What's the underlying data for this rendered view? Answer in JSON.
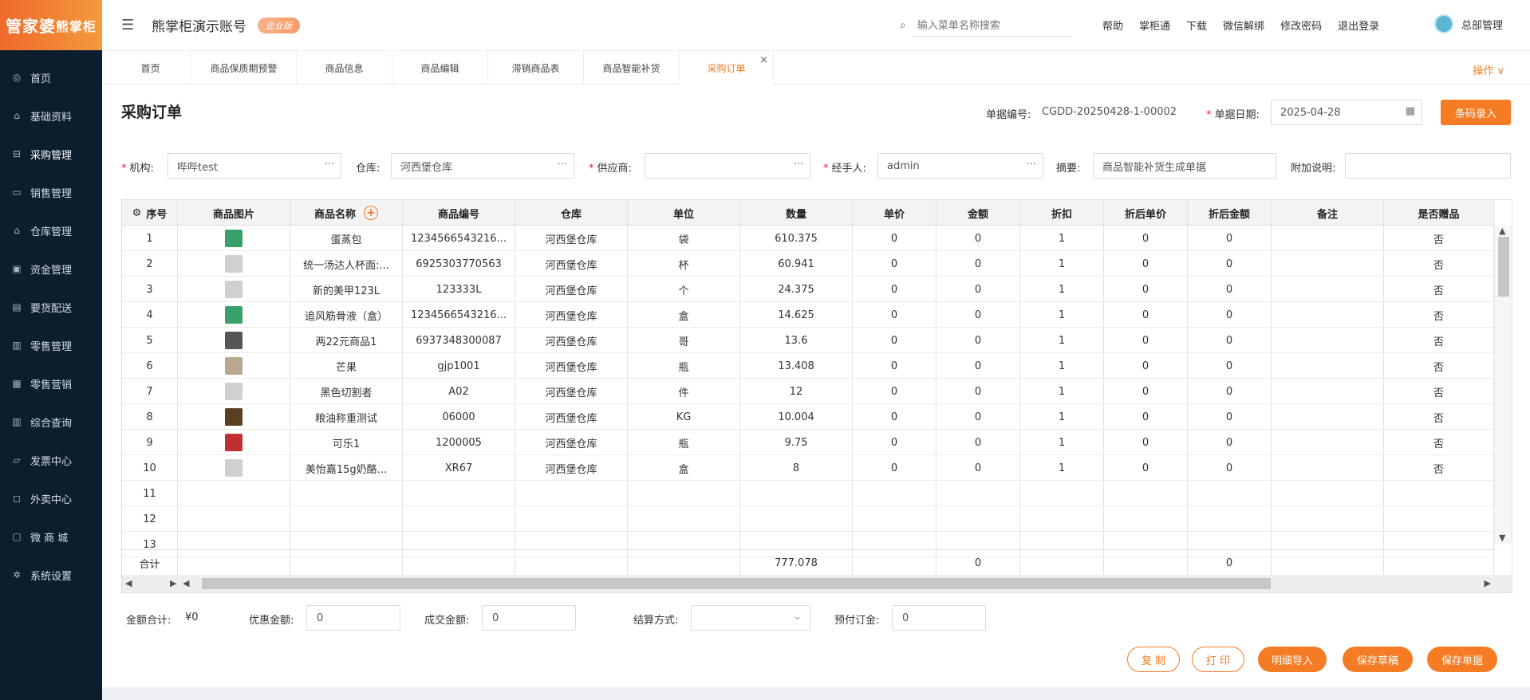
{
  "logo": {
    "brand": "管家婆",
    "sub": "熊掌柜"
  },
  "sidebar": {
    "items": [
      {
        "label": "首页",
        "icon": "globe-icon",
        "glyph": "◎"
      },
      {
        "label": "基础资料",
        "icon": "home-icon",
        "glyph": "⌂"
      },
      {
        "label": "采购管理",
        "icon": "cart-icon",
        "glyph": "⊟"
      },
      {
        "label": "销售管理",
        "icon": "sales-icon",
        "glyph": "▭"
      },
      {
        "label": "仓库管理",
        "icon": "warehouse-icon",
        "glyph": "⌂"
      },
      {
        "label": "资金管理",
        "icon": "fund-icon",
        "glyph": "▣"
      },
      {
        "label": "要货配送",
        "icon": "delivery-icon",
        "glyph": "▤"
      },
      {
        "label": "零售管理",
        "icon": "retail-icon",
        "glyph": "▥"
      },
      {
        "label": "零售营销",
        "icon": "gift-icon",
        "glyph": "▦"
      },
      {
        "label": "综合查询",
        "icon": "chart-icon",
        "glyph": "▥"
      },
      {
        "label": "发票中心",
        "icon": "invoice-icon",
        "glyph": "▱"
      },
      {
        "label": "外卖中心",
        "icon": "takeout-icon",
        "glyph": "◻"
      },
      {
        "label": "微 商 城",
        "icon": "shop-icon",
        "glyph": "▢"
      },
      {
        "label": "系统设置",
        "icon": "gear-icon",
        "glyph": "✲"
      }
    ]
  },
  "topbar": {
    "account_name": "熊掌柜演示账号",
    "badge": "企业版",
    "search_placeholder": "输入菜单名称搜索",
    "links": [
      "帮助",
      "掌柜通",
      "下载",
      "微信解绑",
      "修改密码",
      "退出登录"
    ],
    "user": "总部管理"
  },
  "tabs": [
    "首页",
    "商品保质期预警",
    "商品信息",
    "商品编辑",
    "滞销商品表",
    "商品智能补货",
    "采购订单"
  ],
  "ops_label": "操作 ∨",
  "form": {
    "title": "采购订单",
    "doc_no_label": "单据编号:",
    "doc_no": "CGDD-20250428-1-00002",
    "date_label": "单据日期:",
    "date": "2025-04-28",
    "barcode_btn": "条码录入",
    "org_label": "机构:",
    "org": "哔哔test",
    "wh_label": "仓库:",
    "wh": "河西堡仓库",
    "supplier_label": "供应商:",
    "supplier": "",
    "handler_label": "经手人:",
    "handler": "admin",
    "summary_label": "摘要:",
    "summary": "商品智能补货生成单据",
    "note_label": "附加说明:",
    "note": ""
  },
  "table": {
    "headers": [
      "序号",
      "商品图片",
      "商品名称",
      "商品编号",
      "仓库",
      "单位",
      "数量",
      "单价",
      "金额",
      "折扣",
      "折后单价",
      "折后金额",
      "备注",
      "是否赠品"
    ],
    "rows": [
      {
        "no": "1",
        "thumb": "#3aa06a",
        "name": "蛋蒸包",
        "code": "1234566543216...",
        "wh": "河西堡仓库",
        "unit": "袋",
        "qty": "610.375",
        "price": "0",
        "amt": "0",
        "disc": "1",
        "dprice": "0",
        "damt": "0",
        "remark": "",
        "gift": "否"
      },
      {
        "no": "2",
        "thumb": "#d0d0d0",
        "name": "统一汤达人杯面:...",
        "code": "6925303770563",
        "wh": "河西堡仓库",
        "unit": "杯",
        "qty": "60.941",
        "price": "0",
        "amt": "0",
        "disc": "1",
        "dprice": "0",
        "damt": "0",
        "remark": "",
        "gift": "否"
      },
      {
        "no": "3",
        "thumb": "#d0d0d0",
        "name": "新的美甲123L",
        "code": "123333L",
        "wh": "河西堡仓库",
        "unit": "个",
        "qty": "24.375",
        "price": "0",
        "amt": "0",
        "disc": "1",
        "dprice": "0",
        "damt": "0",
        "remark": "",
        "gift": "否"
      },
      {
        "no": "4",
        "thumb": "#3aa06a",
        "name": "追风筋骨液（盒）",
        "code": "1234566543216...",
        "wh": "河西堡仓库",
        "unit": "盒",
        "qty": "14.625",
        "price": "0",
        "amt": "0",
        "disc": "1",
        "dprice": "0",
        "damt": "0",
        "remark": "",
        "gift": "否"
      },
      {
        "no": "5",
        "thumb": "#555555",
        "name": "两22元商品1",
        "code": "6937348300087",
        "wh": "河西堡仓库",
        "unit": "哥",
        "qty": "13.6",
        "price": "0",
        "amt": "0",
        "disc": "1",
        "dprice": "0",
        "damt": "0",
        "remark": "",
        "gift": "否"
      },
      {
        "no": "6",
        "thumb": "#b8a890",
        "name": "芒果",
        "code": "gjp1001",
        "wh": "河西堡仓库",
        "unit": "瓶",
        "qty": "13.408",
        "price": "0",
        "amt": "0",
        "disc": "1",
        "dprice": "0",
        "damt": "0",
        "remark": "",
        "gift": "否"
      },
      {
        "no": "7",
        "thumb": "#d0d0d0",
        "name": "黑色切割者",
        "code": "A02",
        "wh": "河西堡仓库",
        "unit": "件",
        "qty": "12",
        "price": "0",
        "amt": "0",
        "disc": "1",
        "dprice": "0",
        "damt": "0",
        "remark": "",
        "gift": "否"
      },
      {
        "no": "8",
        "thumb": "#5a4020",
        "name": "粮油称重测试",
        "code": "06000",
        "wh": "河西堡仓库",
        "unit": "KG",
        "qty": "10.004",
        "price": "0",
        "amt": "0",
        "disc": "1",
        "dprice": "0",
        "damt": "0",
        "remark": "",
        "gift": "否"
      },
      {
        "no": "9",
        "thumb": "#c03030",
        "name": "可乐1",
        "code": "1200005",
        "wh": "河西堡仓库",
        "unit": "瓶",
        "qty": "9.75",
        "price": "0",
        "amt": "0",
        "disc": "1",
        "dprice": "0",
        "damt": "0",
        "remark": "",
        "gift": "否"
      },
      {
        "no": "10",
        "thumb": "#d0d0d0",
        "name": "美怡嘉15g奶酪...",
        "code": "XR67",
        "wh": "河西堡仓库",
        "unit": "盒",
        "qty": "8",
        "price": "0",
        "amt": "0",
        "disc": "1",
        "dprice": "0",
        "damt": "0",
        "remark": "",
        "gift": "否"
      },
      {
        "no": "11"
      },
      {
        "no": "12"
      },
      {
        "no": "13"
      }
    ],
    "sum_label": "合计",
    "sum_qty": "777.078",
    "sum_amt": "0",
    "sum_damt": "0"
  },
  "footer": {
    "total_label": "金额合计:",
    "total": "¥0",
    "discount_label": "优惠金额:",
    "discount": "0",
    "deal_label": "成交金额:",
    "deal": "0",
    "settle_label": "结算方式:",
    "settle": "",
    "deposit_label": "预付订金:",
    "deposit": "0",
    "buttons": [
      "复 制",
      "打 印",
      "明细导入",
      "保存草稿",
      "保存单据"
    ]
  },
  "colors": {
    "accent": "#f57c24",
    "sidebar": "#0c1e2e"
  }
}
